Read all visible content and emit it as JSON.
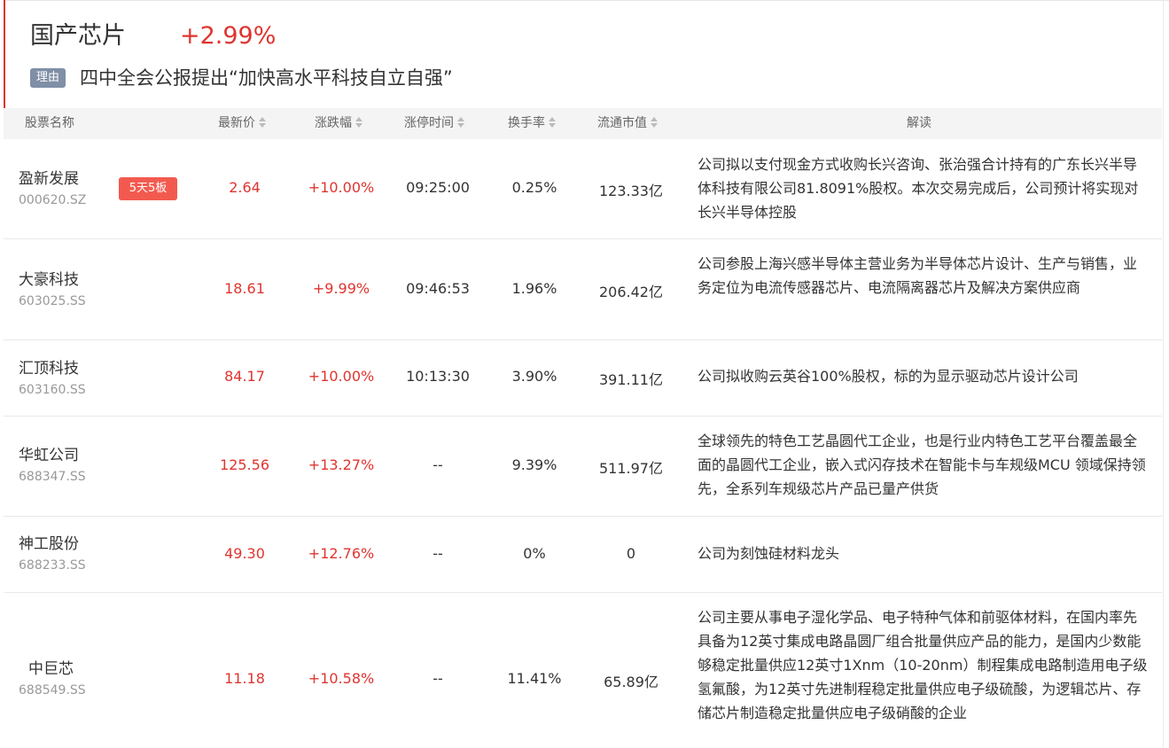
{
  "header": {
    "sector_name": "国产芯片",
    "sector_change": "+2.99%",
    "reason_badge": "理由",
    "reason_text": "四中全会公报提出“加快高水平科技自立自强”"
  },
  "columns": {
    "name": "股票名称",
    "price": "最新价",
    "change": "涨跌幅",
    "limit_time": "涨停时间",
    "turnover": "换手率",
    "market_cap": "流通市值",
    "analysis": "解读"
  },
  "rows": [
    {
      "name": "盈新发展",
      "code": "000620.SZ",
      "tag": "5天5板",
      "price": "2.64",
      "change": "+10.00%",
      "limit_time": "09:25:00",
      "turnover": "0.25%",
      "market_cap": "123.33亿",
      "analysis": "公司拟以支付现金方式收购长兴咨询、张治强合计持有的广东长兴半导体科技有限公司81.8091%股权。本次交易完成后，公司预计将实现对长兴半导体控股"
    },
    {
      "name": "大豪科技",
      "code": "603025.SS",
      "price": "18.61",
      "change": "+9.99%",
      "limit_time": "09:46:53",
      "turnover": "1.96%",
      "market_cap": "206.42亿",
      "analysis": "公司参股上海兴感半导体主营业务为半导体芯片设计、生产与销售，业务定位为电流传感器芯片、电流隔离器芯片及解决方案供应商"
    },
    {
      "name": "汇顶科技",
      "code": "603160.SS",
      "price": "84.17",
      "change": "+10.00%",
      "limit_time": "10:13:30",
      "turnover": "3.90%",
      "market_cap": "391.11亿",
      "analysis": "公司拟收购云英谷100%股权，标的为显示驱动芯片设计公司"
    },
    {
      "name": "华虹公司",
      "code": "688347.SS",
      "price": "125.56",
      "change": "+13.27%",
      "limit_time": "--",
      "turnover": "9.39%",
      "market_cap": "511.97亿",
      "analysis": "全球领先的特色工艺晶圆代工企业，也是行业内特色工艺平台覆盖最全面的晶圆代工企业，嵌入式闪存技术在智能卡与车规级MCU 领域保持领先，全系列车规级芯片产品已量产供货"
    },
    {
      "name": "神工股份",
      "code": "688233.SS",
      "price": "49.30",
      "change": "+12.76%",
      "limit_time": "--",
      "turnover": "0%",
      "market_cap": "0",
      "analysis": "公司为刻蚀硅材料龙头"
    },
    {
      "name": "中巨芯",
      "code": "688549.SS",
      "price": "11.18",
      "change": "+10.58%",
      "limit_time": "--",
      "turnover": "11.41%",
      "market_cap": "65.89亿",
      "analysis": "公司主要从事电子湿化学品、电子特种气体和前驱体材料，在国内率先具备为12英寸集成电路晶圆厂组合批量供应产品的能力，是国内少数能够稳定批量供应12英寸1Xnm（10-20nm）制程集成电路制造用电子级氢氟酸，为12英寸先进制程稳定批量供应电子级硫酸，为逻辑芯片、存储芯片制造稳定批量供应电子级硝酸的企业"
    }
  ]
}
